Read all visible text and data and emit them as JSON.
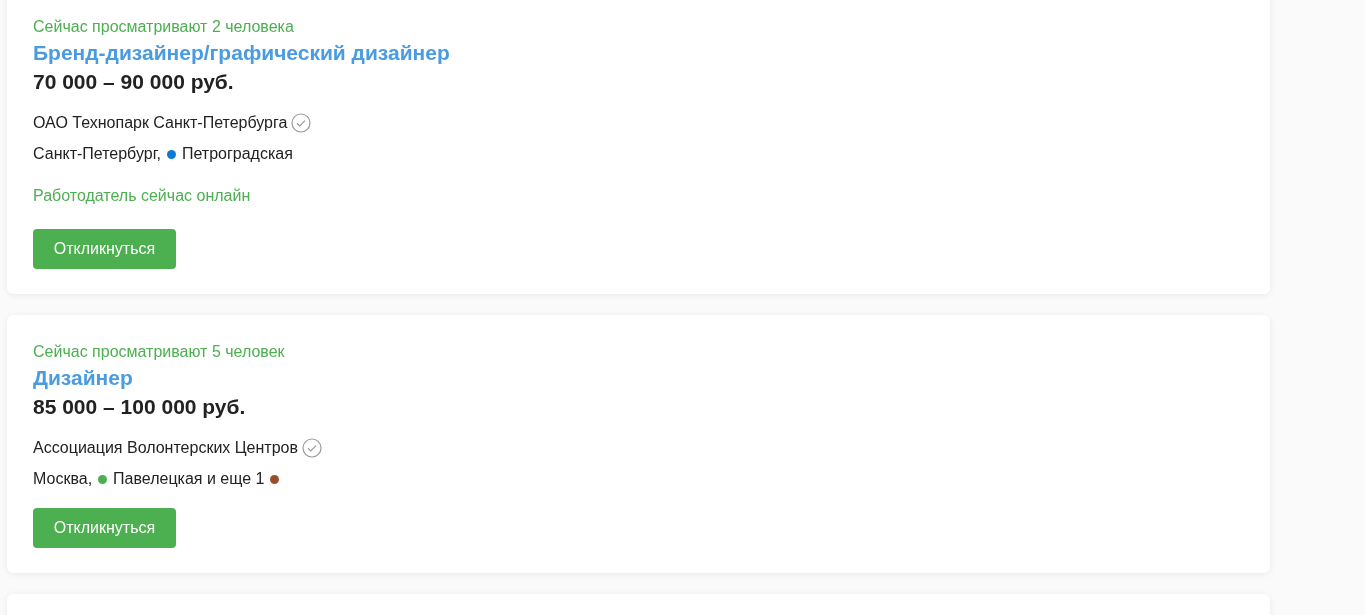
{
  "vacancies": [
    {
      "viewers": "Сейчас просматривают 2 человека",
      "title": "Бренд-дизайнер/графический дизайнер",
      "salary": "70 000 – 90 000 руб.",
      "company": "ОАО Технопарк Санкт-Петербурга",
      "verified": true,
      "location": [
        {
          "kind": "text",
          "text": "Санкт-Петербург,"
        },
        {
          "kind": "dot",
          "color": "#0a7ad4"
        },
        {
          "kind": "text",
          "text": "Петроградская"
        }
      ],
      "online": "Работодатель сейчас онлайн",
      "button": "Откликнуться"
    },
    {
      "viewers": "Сейчас просматривают 5 человек",
      "title": "Дизайнер",
      "salary": "85 000 – 100 000 руб.",
      "company": "Ассоциация Волонтерских Центров",
      "verified": true,
      "location": [
        {
          "kind": "text",
          "text": "Москва,"
        },
        {
          "kind": "dot",
          "color": "#4caf50"
        },
        {
          "kind": "text",
          "text": "Павелецкая и еще 1"
        },
        {
          "kind": "dot",
          "color": "#9a4f2c"
        }
      ],
      "button": "Откликнуться"
    }
  ]
}
